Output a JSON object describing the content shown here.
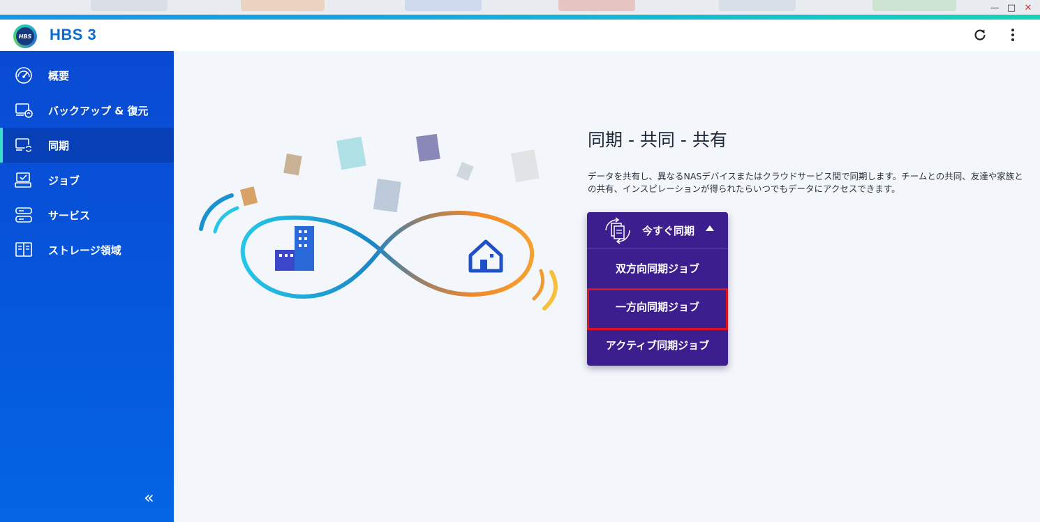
{
  "window": {
    "minimize_symbol": "—",
    "maximize_symbol": "□",
    "close_symbol": "✕"
  },
  "header": {
    "logo_text": "HBS",
    "app_title": "HBS 3",
    "refresh_icon": "refresh-icon",
    "more_icon": "more-vertical-icon"
  },
  "sidebar": {
    "items": [
      {
        "label": "概要",
        "icon": "dashboard-gauge-icon",
        "active": false
      },
      {
        "label": "バックアップ & 復元",
        "icon": "backup-restore-icon",
        "active": false
      },
      {
        "label": "同期",
        "icon": "sync-icon",
        "active": true
      },
      {
        "label": "ジョブ",
        "icon": "jobs-icon",
        "active": false
      },
      {
        "label": "サービス",
        "icon": "services-icon",
        "active": false
      },
      {
        "label": "ストレージ領域",
        "icon": "storage-space-icon",
        "active": false
      }
    ],
    "collapse_symbol": "«"
  },
  "main": {
    "title": "同期 - 共同 - 共有",
    "description": "データを共有し、異なるNASデバイスまたはクラウドサービス間で同期します。チームとの共同、友達や家族との共有、インスピレーションが得られたらいつでもデータにアクセスできます。",
    "sync_now": {
      "label": "今すぐ同期",
      "options": [
        {
          "label": "双方向同期ジョブ",
          "highlighted": false
        },
        {
          "label": "一方向同期ジョブ",
          "highlighted": true
        },
        {
          "label": "アクティブ同期ジョブ",
          "highlighted": false
        }
      ]
    }
  },
  "colors": {
    "accent": "#0c6bd1",
    "sidebar": "#0a4ad3",
    "sidebar_active": "#0740b6",
    "dropdown": "#3c1e8f",
    "highlight": "#e0121d"
  }
}
